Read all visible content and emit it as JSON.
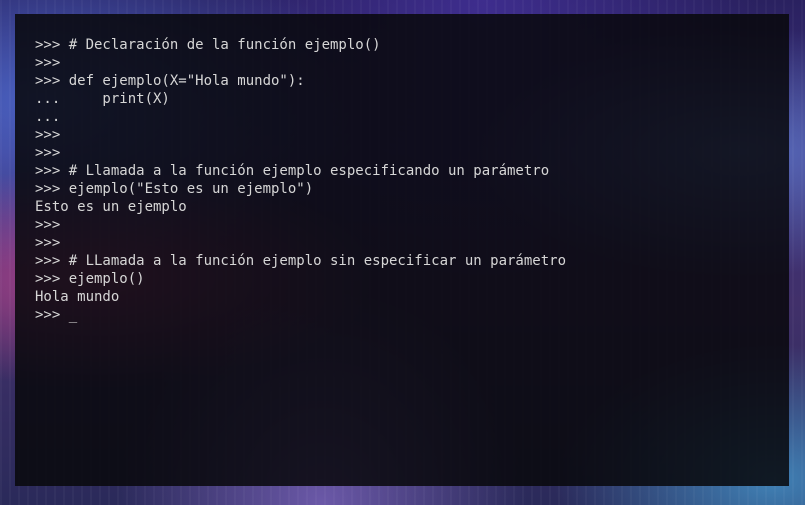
{
  "terminal": {
    "lines": [
      ">>> # Declaración de la función ejemplo()",
      ">>>",
      ">>> def ejemplo(X=\"Hola mundo\"):",
      "...     print(X)",
      "...",
      ">>>",
      ">>>",
      ">>> # Llamada a la función ejemplo especificando un parámetro",
      ">>> ejemplo(\"Esto es un ejemplo\")",
      "Esto es un ejemplo",
      ">>>",
      ">>>",
      ">>> # LLamada a la función ejemplo sin especificar un parámetro",
      ">>> ejemplo()",
      "Hola mundo",
      ">>> _"
    ]
  }
}
